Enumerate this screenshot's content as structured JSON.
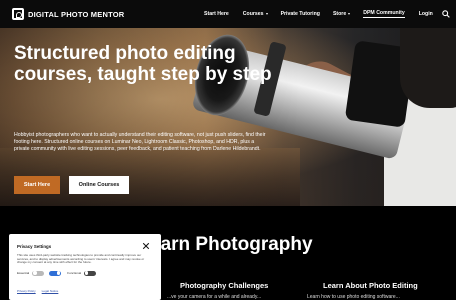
{
  "header": {
    "logo_text": "DIGITAL PHOTO MENTOR",
    "nav": [
      {
        "label": "Start Here"
      },
      {
        "label": "Courses"
      },
      {
        "label": "Private Tutoring"
      },
      {
        "label": "Store"
      },
      {
        "label": "DPM Community"
      },
      {
        "label": "Login"
      }
    ]
  },
  "hero": {
    "title": "Structured photo editing courses, taught step by step",
    "description": "Hobbyist photographers who want to actually understand their editing software, not just push sliders, find their footing here. Structured online courses on Luminar Neo, Lightroom Classic, Photoshop, and HDR, plus a private community with live editing sessions, peer feedback, and patient teaching from Darlene Hildebrandt.",
    "primary_button": "Start Here",
    "secondary_button": "Online Courses"
  },
  "section": {
    "heading": "earn Photography",
    "columns": [
      {
        "title": "Photography Challenges",
        "text": "...ve your camera for a while and already..."
      },
      {
        "title": "Learn About Photo Editing",
        "text": "Learn how to use photo editing software..."
      }
    ]
  },
  "privacy": {
    "title": "Privacy Settings",
    "text": "This site uses third-party website tracking technologies to provide and continually improve our services, and to display advertisements according to users' interests. I agree and may revoke or change my consent at any time with effect for the future.",
    "toggles": [
      {
        "label": "Essential",
        "state": "off"
      },
      {
        "label": "Functional",
        "state": "on"
      },
      {
        "label": "Marketing",
        "state": "off"
      }
    ],
    "links": [
      "Privacy Policy",
      "Legal Notice"
    ]
  },
  "colors": {
    "accent_orange": "#c06a24",
    "link_blue": "#2f4fa6",
    "toggle_blue": "#2f6fd6"
  }
}
